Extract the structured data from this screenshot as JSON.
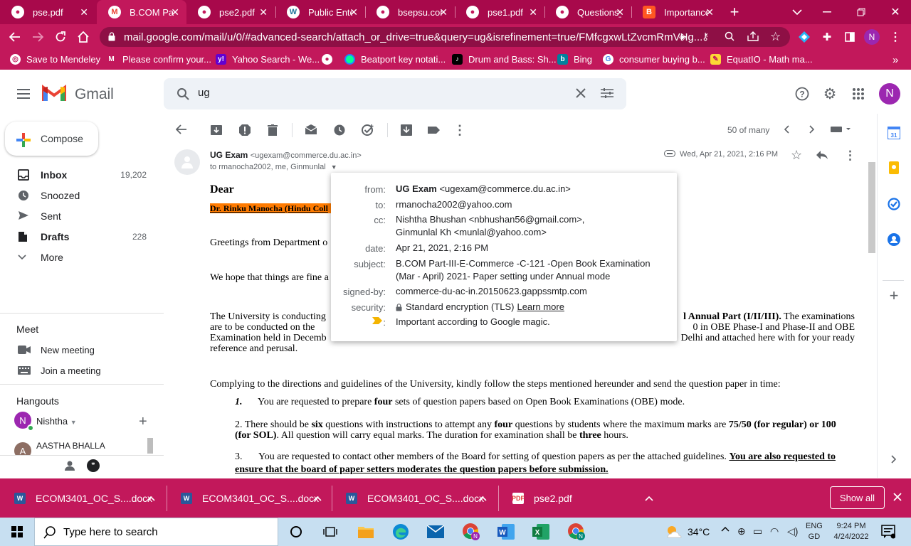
{
  "browser": {
    "tabs": [
      {
        "title": "pse.pdf",
        "icon": "chrome-icon",
        "active": false
      },
      {
        "title": "B.COM Part",
        "icon": "gmail-icon",
        "active": true
      },
      {
        "title": "pse2.pdf",
        "icon": "chrome-icon",
        "active": false
      },
      {
        "title": "Public Enter",
        "icon": "wordpress-icon",
        "active": false
      },
      {
        "title": "bsepsu.com",
        "icon": "chrome-icon",
        "active": false
      },
      {
        "title": "pse1.pdf",
        "icon": "chrome-icon",
        "active": false
      },
      {
        "title": "Questions_l",
        "icon": "chrome-icon",
        "active": false
      },
      {
        "title": "Importance",
        "icon": "blogger-icon",
        "active": false
      }
    ],
    "url": "mail.google.com/mail/u/0/#advanced-search/attach_or_drive=true&query=ug&isrefinement=true/FMfcgxwLtZvcmRmVHg...",
    "profile_initial": "N",
    "bookmarks": [
      {
        "label": "Save to Mendeley",
        "icon": "mendeley-icon"
      },
      {
        "label": "Please confirm your...",
        "icon": "gmail-icon"
      },
      {
        "label": "Yahoo Search - We...",
        "icon": "yahoo-icon"
      },
      {
        "label": "Beatport key notati...",
        "icon": "beatport-icon"
      },
      {
        "label": "Drum and Bass: Sh...",
        "icon": "tiktok-icon"
      },
      {
        "label": "Bing",
        "icon": "bing-icon"
      },
      {
        "label": "consumer buying b...",
        "icon": "google-icon"
      },
      {
        "label": "EquatIO - Math ma...",
        "icon": "equatio-icon"
      }
    ],
    "bookmarks_more": "»"
  },
  "gmail": {
    "logo_text": "Gmail",
    "search_value": "ug",
    "avatar_initial": "N",
    "compose_label": "Compose",
    "nav": [
      {
        "label": "Inbox",
        "count": "19,202",
        "icon": "inbox-icon",
        "bold": true
      },
      {
        "label": "Snoozed",
        "count": "",
        "icon": "clock-icon",
        "bold": false
      },
      {
        "label": "Sent",
        "count": "",
        "icon": "send-icon",
        "bold": false
      },
      {
        "label": "Drafts",
        "count": "228",
        "icon": "draft-icon",
        "bold": true
      },
      {
        "label": "More",
        "count": "",
        "icon": "chevron-down-icon",
        "bold": false
      }
    ],
    "meet": {
      "title": "Meet",
      "new_meeting": "New meeting",
      "join_meeting": "Join a meeting"
    },
    "hangouts": {
      "title": "Hangouts",
      "user": "Nishtha",
      "user_initial": "N",
      "contact": "AASTHA BHALLA",
      "contact_initial": "A"
    },
    "pager": "50 of many"
  },
  "message": {
    "sender_name": "UG Exam",
    "sender_email": "<ugexam@commerce.du.ac.in>",
    "recipients": "to rmanocha2002, me, Ginmunlal",
    "date": "Wed, Apr 21, 2021, 2:16 PM",
    "greeting": "Dear",
    "addressee": "Dr. Rinku Manocha (Hindu Coll",
    "p1": "Greetings from Department o",
    "p2": "We hope that things are fine a",
    "p3_left": "The University is conducting",
    "p3_right": "l Annual Part (I/II/III).",
    "p3_right_tail": " The examinations",
    "p3_line2_left": "are to be conducted on the",
    "p3_line2_right": "0 in OBE Phase-I and Phase-II and OBE",
    "p3_line3_left": "Examination held in Decemb",
    "p3_line3_right": "Delhi and attached here with for your ready",
    "p3_line4": "reference and perusal.",
    "p4": "Complying to the directions and guidelines of the University, kindly follow the steps mentioned hereunder and send the question paper in time:",
    "item1_num": "1.",
    "item1_pre": "You are requested to prepare ",
    "item1_bold": "four",
    "item1_post": " sets of question papers based on Open Book Examinations (OBE) mode.",
    "item2_l1_pre": "2. There should be ",
    "item2_l1_b1": "six",
    "item2_l1_mid": " questions with instructions to attempt any ",
    "item2_l1_b2": "four",
    "item2_l1_mid2": " questions by students where the maximum marks are ",
    "item2_l1_b3": "75/50 (for regular) or 100",
    "item2_l2_b": "(for SOL)",
    "item2_l2_mid": ". All question will carry equal marks. The duration for examination shall be ",
    "item2_l2_b2": "three",
    "item2_l2_post": " hours.",
    "item3_num": "3.",
    "item3_pre": "You are requested to contact other members of the Board for setting of question papers as per the attached guidelines. ",
    "item3_link": "You are also requested to",
    "item3_l2": "ensure that the board of paper setters moderates the question papers before submission."
  },
  "popup": {
    "from_label": "from:",
    "from_name": "UG Exam",
    "from_email": "<ugexam@commerce.du.ac.in>",
    "to_label": "to:",
    "to_value": "rmanocha2002@yahoo.com",
    "cc_label": "cc:",
    "cc_value1": "Nishtha Bhushan <nbhushan56@gmail.com>,",
    "cc_value2": "Ginmunlal Kh <munlal@yahoo.com>",
    "date_label": "date:",
    "date_value": "Apr 21, 2021, 2:16 PM",
    "subject_label": "subject:",
    "subject_value": "B.COM Part-III-E-Commerce -C-121 -Open Book Examination (Mar - April) 2021- Paper setting under Annual mode",
    "signed_label": "signed-by:",
    "signed_value": "commerce-du-ac-in.20150623.gappssmtp.com",
    "security_label": "security:",
    "security_value": "Standard encryption (TLS)",
    "learn_more": "Learn more",
    "important_label": ":",
    "important_value": "Important according to Google magic."
  },
  "downloads": {
    "items": [
      {
        "name": "ECOM3401_OC_S....docx",
        "icon": "word-icon"
      },
      {
        "name": "ECOM3401_OC_S....docx",
        "icon": "word-icon"
      },
      {
        "name": "ECOM3401_OC_S....docx",
        "icon": "word-icon"
      },
      {
        "name": "pse2.pdf",
        "icon": "pdf-icon"
      }
    ],
    "show_all": "Show all"
  },
  "taskbar": {
    "search_placeholder": "Type here to search",
    "temperature": "34°C",
    "lang_top": "ENG",
    "lang_bottom": "GD",
    "time": "9:24 PM",
    "date": "4/24/2022"
  },
  "colors": {
    "chrome_theme": "#c2185b",
    "tab_strip": "#a8094b",
    "highlight_orange": "#ff7b00",
    "gmail_search_bg": "#eef2f7",
    "avatar": "#9c27b0"
  }
}
